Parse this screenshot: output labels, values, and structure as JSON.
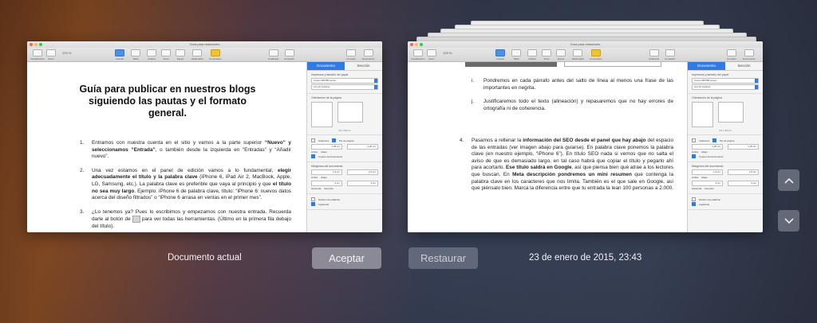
{
  "app": {
    "window_title": "Guía para redactores"
  },
  "toolbar": {
    "left": [
      "Visualización",
      "Zoom"
    ],
    "zoom_value": "125 %",
    "center": [
      "Insertar",
      "Tabla",
      "Gráfica",
      "Texto",
      "Figura",
      "Multimedia",
      "Comentario"
    ],
    "right": [
      "Colaborar",
      "Compartir"
    ],
    "far_right": [
      "Formato",
      "Documento"
    ]
  },
  "sidebar": {
    "tabs": [
      "Documento",
      "Sección"
    ],
    "printer_heading": "Impresora y tamaño del papel",
    "printer": "Canon MP280 series",
    "paper": "A4 (sin bordes)",
    "orientation_heading": "Orientación de la página",
    "page_size": "21 × 30 cm",
    "header_label": "Cabecera",
    "footer_label": "Pie de página",
    "header_value": "1,25 cm",
    "footer_value": "1,25 cm",
    "top_label": "Arriba",
    "bottom_label": "Abajo",
    "body_label": "Cuerpo del documento",
    "margins_heading": "Márgenes del documento",
    "margin_top": "1,9 cm",
    "margin_bottom": "2,5 cm",
    "margin_left": "3 cm",
    "margin_right": "3 cm",
    "left_label": "Izquierda",
    "right_label": "Derecha",
    "hyphen_label": "División de palabras",
    "ligatures_label": "Ligaduras"
  },
  "current_doc": {
    "title": "Guía para publicar en nuestros blogs siguiendo las pautas y el formato general.",
    "items": [
      {
        "num": "1.",
        "parts": [
          {
            "t": "Entramos con nuestra cuenta en el sitio y vamos a la parte superior  "
          },
          {
            "t": "“Nuevo” y seleccionamos “Entrada”",
            "b": true
          },
          {
            "t": ", o también desde la izquierda en “Entradas” y “Añadir nuevo”."
          }
        ]
      },
      {
        "num": "2.",
        "parts": [
          {
            "t": "Una vez estamos en el panel de edición vamos a lo fundamental, "
          },
          {
            "t": "elegir adecuadamente el título y la palabra clave",
            "b": true
          },
          {
            "t": " (iPhone 6, iPad Air 2, MacBook, Apple, LG, Samsung, etc.). La palabra clave es preferible que vaya al principio y que "
          },
          {
            "t": "el título no sea muy largo",
            "b": true
          },
          {
            "t": ". Ejemplo: iPhone 6 de palabra clave, título: “iPhone 6: nuevos datos acerca del diseño filtrados” o “iPhone 6 arrasa en ventas en el primer mes”."
          }
        ]
      },
      {
        "num": "3.",
        "parts": [
          {
            "t": "¿Lo tenemos ya? Pues lo escribimos y empezamos con nuestra entrada. Recuerda darle al botón de "
          },
          {
            "icon": true
          },
          {
            "t": " para ver todas las herramientas. (Último en la primera fila debajo del título)."
          }
        ]
      }
    ]
  },
  "saved_doc": {
    "sub_items": [
      {
        "num": "i.",
        "parts": [
          {
            "t": "Pondremos en cada párrafo antes del salto de línea al menos una frase de las importantes en negrita."
          }
        ]
      },
      {
        "num": "j.",
        "parts": [
          {
            "t": "Justificaremos todo el texto (alineación) y repasaremos que no hay errores de ortografía ni de coherencia."
          }
        ]
      }
    ],
    "item4": {
      "num": "4.",
      "parts": [
        {
          "t": "Pasamos a rellenar la "
        },
        {
          "t": "información del SEO desde el panel que hay abajo",
          "b": true
        },
        {
          "t": " del espacio de las entradas (ver imagen abajo para guiarse). En palabra clave ponemos la palabra clave (en nuestro ejemplo, “iPhone 6”). En título SEO nada si vemos que no salta el aviso de que es demasiado largo, en tal caso habrá que copiar el título y pegarlo ahí para acortarlo. "
        },
        {
          "t": "Ese título saldrá en Google",
          "b": true
        },
        {
          "t": ", así que piensa bien qué atrae a los lectores que buscan. En "
        },
        {
          "t": "Meta descripción pondremos un mini resumen",
          "b": true
        },
        {
          "t": " que contenga la palabra clave en los caracteres que nos limita. También es el que sale en Google, así que piénsalo bien. Marca la diferencia entre que tu entrada la lean 100 personas a 2.000."
        }
      ]
    }
  },
  "footer": {
    "current_label": "Documento actual",
    "accept": "Aceptar",
    "restore": "Restaurar",
    "timestamp": "23 de enero de 2015, 23:43"
  },
  "nav": {
    "up_icon": "chevron-up-icon",
    "down_icon": "chevron-down-icon"
  }
}
